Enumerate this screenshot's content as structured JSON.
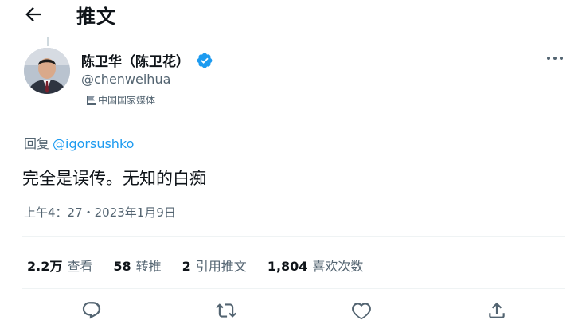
{
  "header": {
    "title": "推文",
    "back_icon": "arrow-left-icon"
  },
  "author": {
    "display_name": "陈卫华（陈卫花）",
    "handle": "@chenweihua",
    "verified": true,
    "verified_color": "#1d9bf0",
    "affiliation_label": "中国国家媒体"
  },
  "tweet": {
    "reply_prefix": "回复",
    "reply_to": "@igorsushko",
    "text": "完全是误传。无知的白痴",
    "timestamp": "上午4：27・2023年1月9日"
  },
  "stats": [
    {
      "value": "2.2万",
      "label": "查看"
    },
    {
      "value": "58",
      "label": "转推"
    },
    {
      "value": "2",
      "label": "引用推文"
    },
    {
      "value": "1,804",
      "label": "喜欢次数"
    }
  ],
  "actions": [
    "reply-icon",
    "retweet-icon",
    "like-icon",
    "share-icon"
  ],
  "colors": {
    "accent": "#1d9bf0",
    "text": "#0f1419",
    "secondary": "#536471"
  }
}
